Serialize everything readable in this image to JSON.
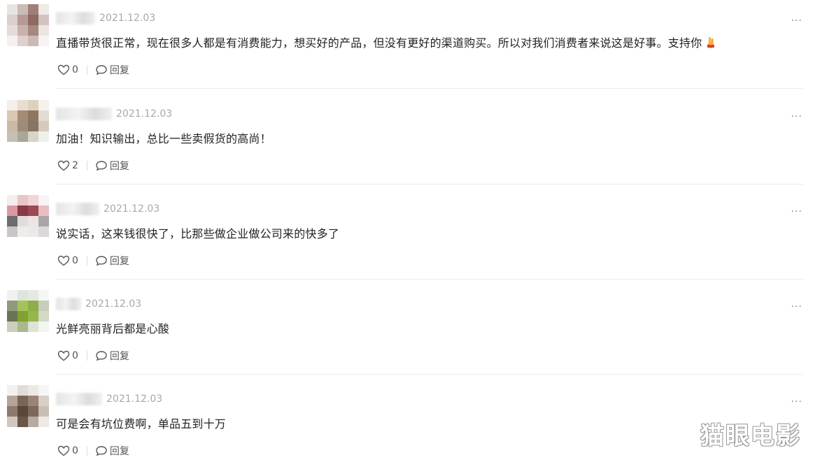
{
  "comments": [
    {
      "date": "2021.12.03",
      "text": "直播带货很正常，现在很多人都是有消费能力，想买好的产品，但没有更好的渠道购买。所以对我们消费者来说这是好事。支持你",
      "like_count": "0",
      "reply_label": "回复",
      "more_label": "···",
      "emoji_icon": "ok-hand-emoji-icon"
    },
    {
      "date": "2021.12.03",
      "text": "加油！知识输出，总比一些卖假货的高尚！",
      "like_count": "2",
      "reply_label": "回复",
      "more_label": "···"
    },
    {
      "date": "2021.12.03",
      "text": "说实话，这来钱很快了，比那些做企业做公司来的快多了",
      "like_count": "0",
      "reply_label": "回复",
      "more_label": "···"
    },
    {
      "date": "2021.12.03",
      "text": "光鲜亮丽背后都是心酸",
      "like_count": "0",
      "reply_label": "回复",
      "more_label": "···"
    },
    {
      "date": "2021.12.03",
      "text": "可是会有坑位费啊，单品五到十万",
      "like_count": "0",
      "reply_label": "回复",
      "more_label": "···"
    }
  ],
  "watermark": "猫眼电影",
  "colors": {
    "date": "#a8a8a8",
    "text": "#222222",
    "action": "#555555",
    "divider": "#ececec"
  }
}
